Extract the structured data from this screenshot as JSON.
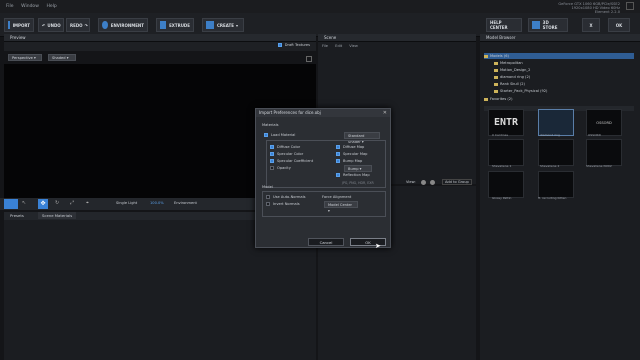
{
  "menu": [
    "File",
    "Window",
    "Help"
  ],
  "sysinfo": [
    "GeForce GTX 1060 6GB/PCIe/SSE2",
    "1920x1080 HD Video 60Hz"
  ],
  "element": {
    "label": "Element",
    "version": "2.2.0"
  },
  "toolbar": {
    "import": "IMPORT",
    "undo": "UNDO",
    "redo": "REDO",
    "environment": "ENVIRONMENT",
    "extrude": "EXTRUDE",
    "create": "CREATE",
    "help_center": "HELP CENTER",
    "store": "3D STORE",
    "x": "X",
    "ok": "OK"
  },
  "preview": {
    "title": "Preview",
    "draft_textures": "Draft Textures",
    "perspective": "Perspective",
    "shaded": "Shaded"
  },
  "scene": {
    "title": "Scene",
    "menu": [
      "File",
      "Edit",
      "View"
    ]
  },
  "bottom_bar": {
    "single_light": "Single Light",
    "percent": "100.0%",
    "environment": "Environment",
    "view": "View:",
    "add_group": "Add to Group"
  },
  "bottom_tabs": [
    "Presets",
    "Scene Materials"
  ],
  "model_browser": {
    "title": "Model Browser",
    "tree": [
      {
        "label": "Models (6)",
        "level": 0,
        "selected": true
      },
      {
        "label": "Metropolitan",
        "level": 1
      },
      {
        "label": "Motion_Design_2",
        "level": 1
      },
      {
        "label": "diamond ring (2)",
        "level": 1
      },
      {
        "label": "Rank Skull (2)",
        "level": 1
      },
      {
        "label": "Starter_Pack_Physical (92)",
        "level": 1
      },
      {
        "label": "Favorites (2)",
        "level": 0
      }
    ],
    "search_placeholder": "Search...",
    "thumbs": [
      {
        "label": "0 Cardinas",
        "text": "ENTR"
      },
      {
        "label": "diamond ring",
        "text": ""
      },
      {
        "label": "OSSORD",
        "text": "OSSORD"
      },
      {
        "label": "Shevaliene 1",
        "text": ""
      },
      {
        "label": "Shevaliene 2",
        "text": ""
      },
      {
        "label": "Shevaliene NU02",
        "text": ""
      },
      {
        "label": "Glossy Pattin",
        "text": ""
      },
      {
        "label": "ft. recruiting Kitten",
        "text": ""
      }
    ]
  },
  "dialog": {
    "title": "Import Preferences for dice.obj",
    "materials_label": "Materials",
    "load_material": "Load Material",
    "material_type": "Standard Shader",
    "left_opts": [
      "Diffuse Color",
      "Specular Color",
      "Specular Coefficient",
      "Opacity"
    ],
    "right_opts": [
      "Diffuse Map",
      "Specular Map",
      "Bump Map",
      "Reflection Map"
    ],
    "bump_select": "Bump",
    "formats": "JPG, PNG, HDR, EXR",
    "model_label": "Model",
    "auto_normals": "Use Auto-Normals",
    "invert_normals": "Invert Normals",
    "force_alignment": "Force Alignment",
    "alignment": "Model Center",
    "cancel": "Cancel",
    "ok": "OK"
  }
}
